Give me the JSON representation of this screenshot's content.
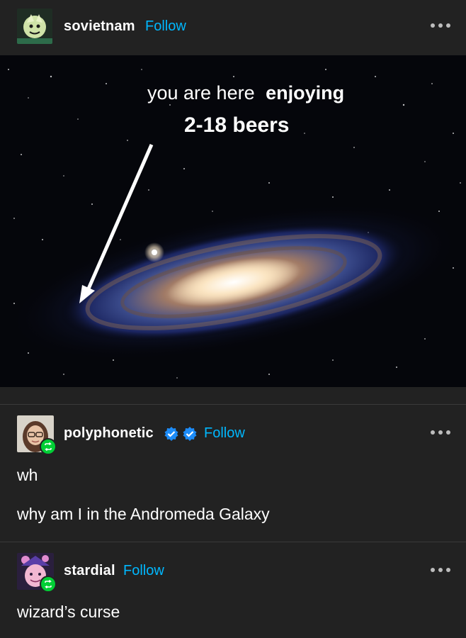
{
  "posts": [
    {
      "username": "sovietnam",
      "follow_label": "Follow",
      "image": {
        "caption_line1_normal": "you are here",
        "caption_line1_bold": "enjoying",
        "caption_line2": "2-18 beers"
      }
    },
    {
      "username": "polyphonetic",
      "follow_label": "Follow",
      "text_lines": [
        "wh",
        "why am I in the Andromeda Galaxy"
      ],
      "badges": [
        "verified-badge-icon",
        "verified-badge-icon"
      ]
    },
    {
      "username": "stardial",
      "follow_label": "Follow",
      "text_lines": [
        "wizard’s curse"
      ]
    }
  ],
  "colors": {
    "background": "#222222",
    "follow": "#00b8ff",
    "verified": "#1d8cf8",
    "reblog": "#00cf35"
  }
}
